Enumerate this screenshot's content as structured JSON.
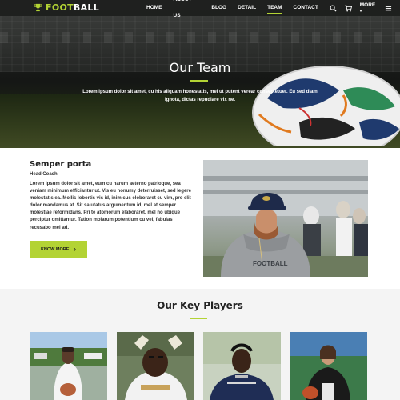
{
  "brand": {
    "logo_prefix": "FOOT",
    "logo_suffix": "BALL",
    "accent": "#b3d334"
  },
  "nav": {
    "items": [
      {
        "label": "HOME"
      },
      {
        "label": "ABOUT US"
      },
      {
        "label": "BLOG"
      },
      {
        "label": "DETAIL"
      },
      {
        "label": "TEAM"
      },
      {
        "label": "CONTACT"
      }
    ],
    "active": "TEAM",
    "more_label": "MORE",
    "icons": [
      "search-icon",
      "cart-icon",
      "menu-icon"
    ]
  },
  "hero": {
    "title": "Our Team",
    "text": "Lorem ipsum dolor sit amet, cu his aliquam honestatis, mel ut putent verear consectetuer. Eu sed diam ignota, dictas repudiare vix ne."
  },
  "coach": {
    "name": "Semper porta",
    "role": "Head Coach",
    "bio": "Lorem ipsum dolor sit amet, eum cu harum aeterno patrioque, sea veniam minimum efficiantur ut. Vis eu nonumy deterruisset, sed legere molestatis ea. Mollis lobortis vis id, inimicus eloboraret cu vim, pro elit dolor mandamus at. Sit salutatus argumentum id, mel at semper molestiae reformidans. Pri te atomorum elaboraret, mel no ubique perciptur omittantur. Tation molarum potentium cu vel, fabulas recusabo mei ad.",
    "button_label": "KNOW MORE",
    "photo_jersey_text": "FOOTBALL"
  },
  "players": {
    "title": "Our Key Players",
    "cards": [
      {
        "name": "player-1"
      },
      {
        "name": "player-2"
      },
      {
        "name": "player-3"
      },
      {
        "name": "player-4"
      }
    ]
  }
}
